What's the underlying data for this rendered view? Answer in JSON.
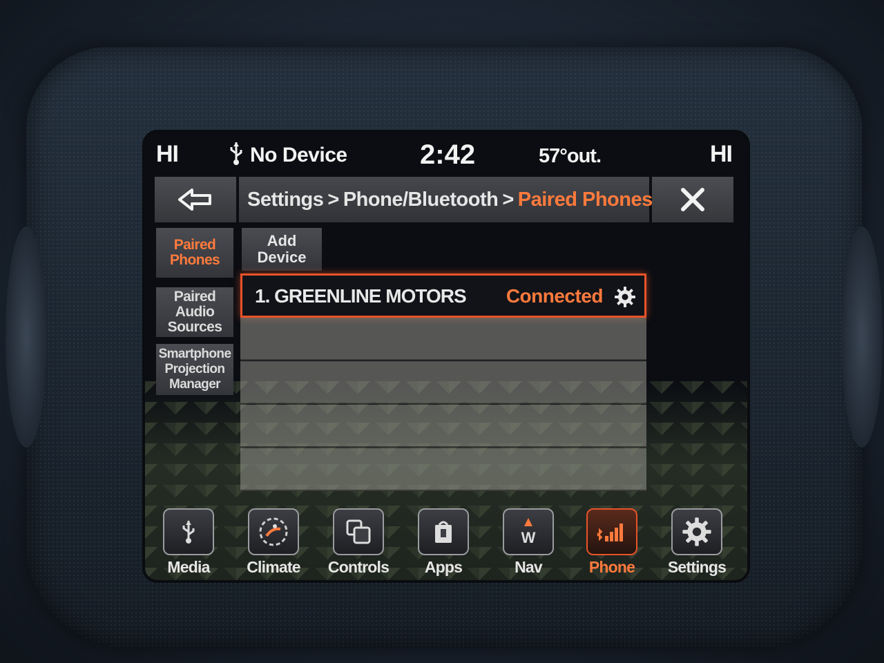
{
  "status": {
    "hi_left": "HI",
    "device": "No Device",
    "clock": "2:42",
    "temp": "57°out.",
    "hi_right": "HI"
  },
  "header": {
    "breadcrumb": [
      "Settings",
      "Phone/Bluetooth",
      "Paired Phones"
    ],
    "separator": ">"
  },
  "side_tabs": [
    {
      "label_lines": [
        "Paired",
        "Phones"
      ],
      "active": true
    },
    {
      "label_lines": [
        "Paired",
        "Audio",
        "Sources"
      ],
      "active": false
    },
    {
      "label_lines": [
        "Smartphone",
        "Projection",
        "Manager"
      ],
      "active": false
    }
  ],
  "add_device": {
    "label_lines": [
      "Add",
      "Device"
    ]
  },
  "devices": [
    {
      "name": "1. GREENLINE MOTORS",
      "status": "Connected"
    }
  ],
  "nav": [
    {
      "label": "Media",
      "icon": "usb-icon"
    },
    {
      "label": "Climate",
      "icon": "climate-icon"
    },
    {
      "label": "Controls",
      "icon": "controls-icon"
    },
    {
      "label": "Apps",
      "icon": "apps-icon"
    },
    {
      "label": "Nav",
      "icon": "compass-icon"
    },
    {
      "label": "Phone",
      "icon": "phone-signal-icon",
      "active": true
    },
    {
      "label": "Settings",
      "icon": "gear-icon"
    }
  ],
  "colors": {
    "accent": "#ff7a3d",
    "highlight_border": "#e8532a"
  }
}
